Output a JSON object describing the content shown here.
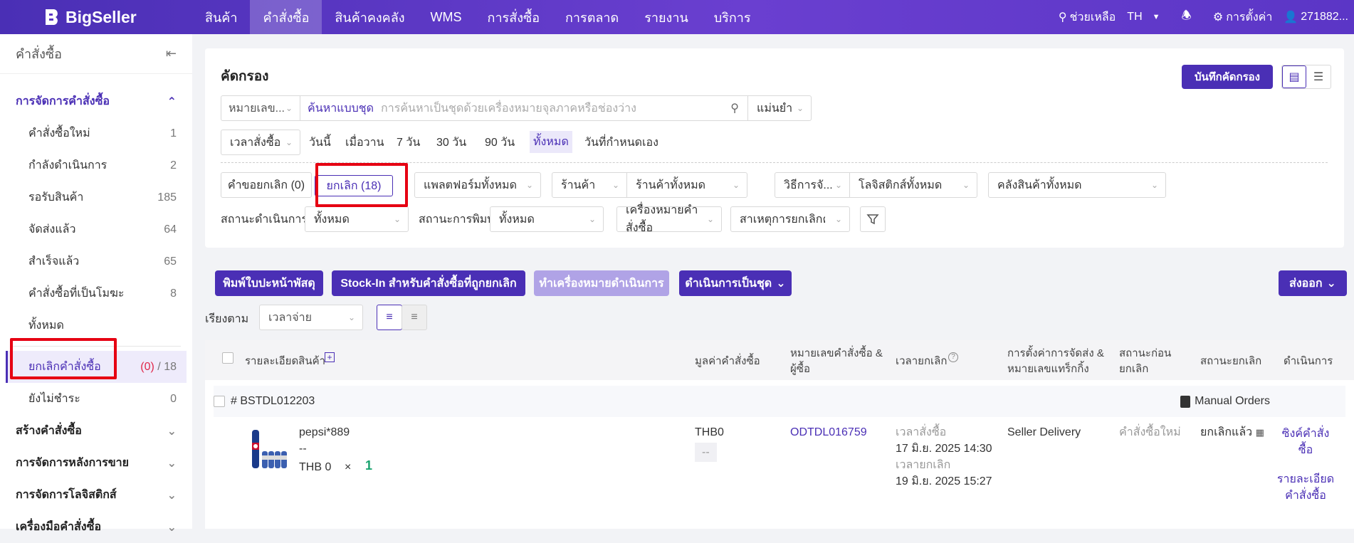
{
  "topbar": {
    "logo": "BigSeller",
    "nav": [
      "สินค้า",
      "คำสั่งซื้อ",
      "สินค้าคงคลัง",
      "WMS",
      "การสั่งซื้อ",
      "การตลาด",
      "รายงาน",
      "บริการ"
    ],
    "active_nav": "คำสั่งซื้อ",
    "help": "ช่วยเหลือ",
    "lang": "TH",
    "settings": "การตั้งค่า",
    "user": "271882..."
  },
  "sidebar": {
    "title": "คำสั่งซื้อ",
    "section_open": "การจัดการคำสั่งซื้อ",
    "items": [
      {
        "label": "คำสั่งซื้อใหม่",
        "count": "1"
      },
      {
        "label": "กำลังดำเนินการ",
        "count": "2"
      },
      {
        "label": "รอรับสินค้า",
        "count": "185"
      },
      {
        "label": "จัดส่งแล้ว",
        "count": "64"
      },
      {
        "label": "สำเร็จแล้ว",
        "count": "65"
      },
      {
        "label": "คำสั่งซื้อที่เป็นโมฆะ",
        "count": "8"
      },
      {
        "label": "ทั้งหมด",
        "count": ""
      }
    ],
    "cancel_item": {
      "label": "ยกเลิกคำสั่งซื้อ",
      "count_red": "(0)",
      "sep": "/",
      "count": "18"
    },
    "unpaid": {
      "label": "ยังไม่ชำระ",
      "count": "0"
    },
    "sections": [
      "สร้างคำสั่งซื้อ",
      "การจัดการหลังการขาย",
      "การจัดการโลจิสติกส์",
      "เครื่องมือคำสั่งซื้อ"
    ]
  },
  "filter": {
    "title": "คัดกรอง",
    "save_btn": "บันทึกคัดกรอง",
    "search_type": "หมายเลข...",
    "batch_search": "ค้นหาแบบชุด",
    "search_placeholder": "การค้นหาเป็นชุดด้วยเครื่องหมายจุลภาคหรือช่องว่าง",
    "match": "แม่นยำ",
    "time_type": "เวลาสั่งซื้อ",
    "time_options": [
      "วันนี้",
      "เมื่อวาน",
      "7 วัน",
      "30 วัน",
      "90 วัน",
      "ทั้งหมด",
      "วันที่กำหนดเอง"
    ],
    "time_selected": "ทั้งหมด",
    "tab_request": "คำขอยกเลิก (0)",
    "tab_cancel": "ยกเลิก (18)",
    "platform": "แพลตฟอร์มทั้งหมด",
    "shop_label": "ร้านค้า",
    "shop": "ร้านค้าทั้งหมด",
    "method_label": "วิธีการจั...",
    "logistics": "โลจิสติกส์ทั้งหมด",
    "warehouse": "คลังสินค้าทั้งหมด",
    "proc_status_label": "สถานะดำเนินการ",
    "proc_status": "ทั้งหมด",
    "print_status_label": "สถานะการพิมพ์",
    "print_status": "ทั้งหมด",
    "order_mark": "เครื่องหมายคำสั่งซื้อ",
    "cancel_reason": "สาเหตุการยกเลิกคำ"
  },
  "actions": {
    "print_label": "พิมพ์ใบปะหน้าพัสดุ",
    "stock_in": "Stock-In สำหรับคำสั่งซื้อที่ถูกยกเลิก",
    "mark_done": "ทำเครื่องหมายดำเนินการ",
    "batch": "ดำเนินการเป็นชุด",
    "export": "ส่งออก",
    "sort_label": "เรียงตาม",
    "sort_value": "เวลาจ่าย"
  },
  "table": {
    "headers": {
      "product": "รายละเอียดสินค้า",
      "value": "มูลค่าคำสั่งซื้อ",
      "order_no": "หมายเลขคำสั่งซื้อ &",
      "order_no2": "ผู้ซื้อ",
      "cancel_time": "เวลายกเลิก",
      "shipping": "การตั้งค่าการจัดส่ง &",
      "shipping2": "หมายเลขแทร็กกิ้ง",
      "prev_status": "สถานะก่อน",
      "prev_status2": "ยกเลิก",
      "cancel_status": "สถานะยกเลิก",
      "action": "ดำเนินการ"
    },
    "group_id": "# BSTDL012203",
    "group_tag": "Manual Orders",
    "row": {
      "product_name": "pepsi*889",
      "product_sku": "--",
      "price": "THB 0",
      "times": "×",
      "qty": "1",
      "value": "THB0",
      "value_sub": "--",
      "order_no": "ODTDL016759",
      "order_time_label": "เวลาสั่งซื้อ",
      "order_time": "17 มิ.ย. 2025 14:30",
      "cancel_time_label": "เวลายกเลิก",
      "cancel_time": "19 มิ.ย. 2025 15:27",
      "shipping": "Seller Delivery",
      "prev_status": "คำสั่งซื้อใหม่",
      "cancel_status": "ยกเลิกแล้ว",
      "act1a": "ซิงค์คำสั่ง",
      "act1b": "ซื้อ",
      "act2a": "รายละเอียด",
      "act2b": "คำสั่งซื้อ"
    }
  }
}
